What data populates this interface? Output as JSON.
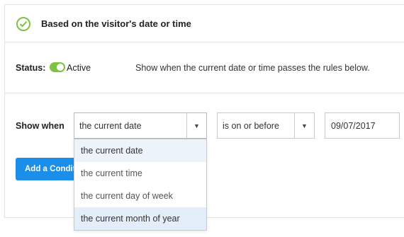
{
  "header": {
    "title": "Based on the visitor's date or time",
    "check_color": "#7cc243"
  },
  "status": {
    "label": "Status:",
    "toggle_on": true,
    "value": "Active",
    "description": "Show when the current date or time passes the rules below."
  },
  "rule": {
    "show_when_label": "Show when",
    "subject_select": {
      "value": "the current date",
      "arrow": "▼"
    },
    "operator_select": {
      "value": "is on or before",
      "arrow": "▼"
    },
    "date_value": "09/07/2017"
  },
  "add_condition": {
    "label": "Add a Condition"
  },
  "dropdown": {
    "options": [
      "the current date",
      "the current time",
      "the current day of week",
      "the current month of year"
    ],
    "selected_index": 0,
    "hovered_index": 3
  },
  "colors": {
    "accent_blue": "#1a8ee8",
    "toggle_green": "#7cc243"
  }
}
